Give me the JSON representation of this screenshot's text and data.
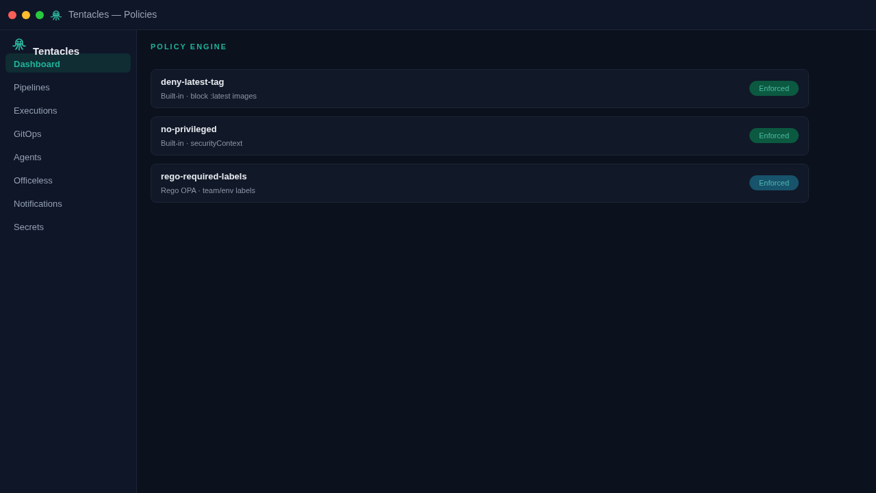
{
  "window": {
    "title": "Tentacles — Policies"
  },
  "sidebar": {
    "brand": "Tentacles",
    "items": [
      {
        "label": "Dashboard",
        "selected": true
      },
      {
        "label": "Pipelines",
        "selected": false
      },
      {
        "label": "Executions",
        "selected": false
      },
      {
        "label": "GitOps",
        "selected": false
      },
      {
        "label": "Agents",
        "selected": false
      },
      {
        "label": "Officeless",
        "selected": false
      },
      {
        "label": "Notifications",
        "selected": false
      },
      {
        "label": "Secrets",
        "selected": false
      }
    ]
  },
  "section_title": "POLICY ENGINE",
  "policies": [
    {
      "name": "deny-latest-tag",
      "description": "Built-in · block :latest images",
      "status": "Enforced",
      "color": "#0b5940"
    },
    {
      "name": "no-privileged",
      "description": "Built-in · securityContext",
      "status": "Enforced",
      "color": "#0b5940"
    },
    {
      "name": "rego-required-labels",
      "description": "Rego OPA · team/env labels",
      "status": "Enforced",
      "color": "#17536b"
    }
  ]
}
